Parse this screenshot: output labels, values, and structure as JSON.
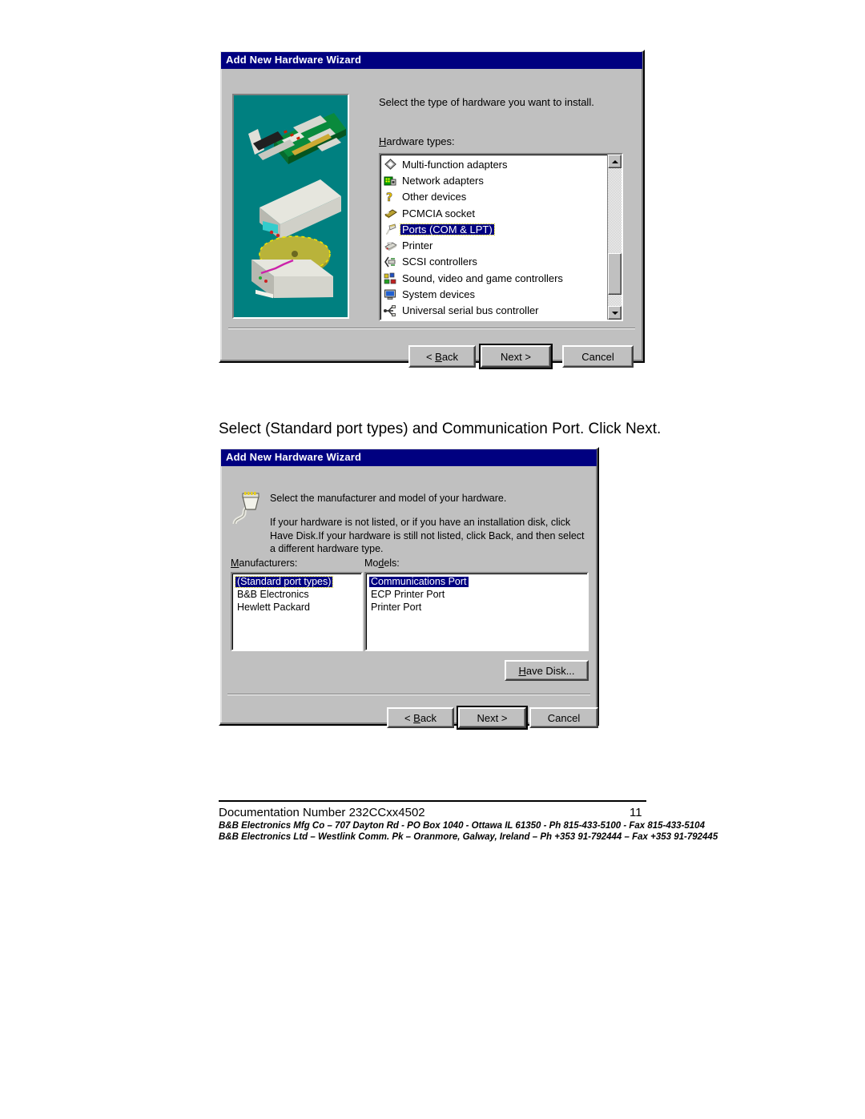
{
  "page": {
    "caption": "Select (Standard port types) and Communication Port. Click Next."
  },
  "dialog1": {
    "title": "Add New Hardware Wizard",
    "prompt": "Select the type of hardware you want to install.",
    "list_label": "Hardware types:",
    "graphic": "hardware-devices-illustration",
    "items": [
      {
        "label": "Multi-function adapters",
        "icon": "diamond-adapter-icon",
        "selected": false
      },
      {
        "label": "Network adapters",
        "icon": "network-card-icon",
        "selected": false
      },
      {
        "label": "Other devices",
        "icon": "question-mark-icon",
        "selected": false
      },
      {
        "label": "PCMCIA socket",
        "icon": "pcmcia-card-icon",
        "selected": false
      },
      {
        "label": "Ports (COM & LPT)",
        "icon": "port-connector-icon",
        "selected": true
      },
      {
        "label": "Printer",
        "icon": "printer-icon",
        "selected": false
      },
      {
        "label": "SCSI controllers",
        "icon": "scsi-controller-icon",
        "selected": false
      },
      {
        "label": "Sound, video and game controllers",
        "icon": "sound-video-icon",
        "selected": false
      },
      {
        "label": "System devices",
        "icon": "computer-icon",
        "selected": false
      },
      {
        "label": "Universal serial bus controller",
        "icon": "usb-icon",
        "selected": false
      }
    ],
    "buttons": {
      "back": "< Back",
      "back_accel": "B",
      "next": "Next >",
      "cancel": "Cancel"
    },
    "scrollbar": {
      "up_icon": "scroll-up-arrow-icon",
      "down_icon": "scroll-down-arrow-icon"
    }
  },
  "dialog2": {
    "title": "Add New Hardware Wizard",
    "icon": "plug-connector-icon",
    "prompt": "Select the manufacturer and model of your hardware.",
    "help_text": "If your hardware is not listed, or if you have an installation disk, click Have Disk.If your hardware is still not listed, click Back, and then select a different hardware type.",
    "manufacturers_label": "Manufacturers:",
    "models_label": "Models:",
    "manufacturers": [
      {
        "label": "(Standard port types)",
        "selected": true
      },
      {
        "label": "B&B Electronics",
        "selected": false
      },
      {
        "label": "Hewlett Packard",
        "selected": false
      }
    ],
    "models": [
      {
        "label": "Communications Port",
        "selected": true
      },
      {
        "label": "ECP Printer Port",
        "selected": false
      },
      {
        "label": "Printer Port",
        "selected": false
      }
    ],
    "buttons": {
      "have_disk": "Have Disk...",
      "have_disk_accel": "H",
      "back": "< Back",
      "back_accel": "B",
      "next": "Next >",
      "cancel": "Cancel"
    }
  },
  "footer": {
    "doc_number": "Documentation Number 232CCxx4502",
    "page_number": "11",
    "address_line1": "B&B Electronics Mfg Co – 707 Dayton Rd - PO Box 1040 - Ottawa IL 61350 - Ph 815-433-5100 - Fax 815-433-5104",
    "address_line2": "B&B Electronics Ltd – Westlink Comm. Pk – Oranmore, Galway, Ireland – Ph +353 91-792444 – Fax +353 91-792445"
  },
  "colors": {
    "dialog_face": "#c0c0c0",
    "titlebar": "#000080",
    "selection": "#000080",
    "art_background": "#008080"
  }
}
